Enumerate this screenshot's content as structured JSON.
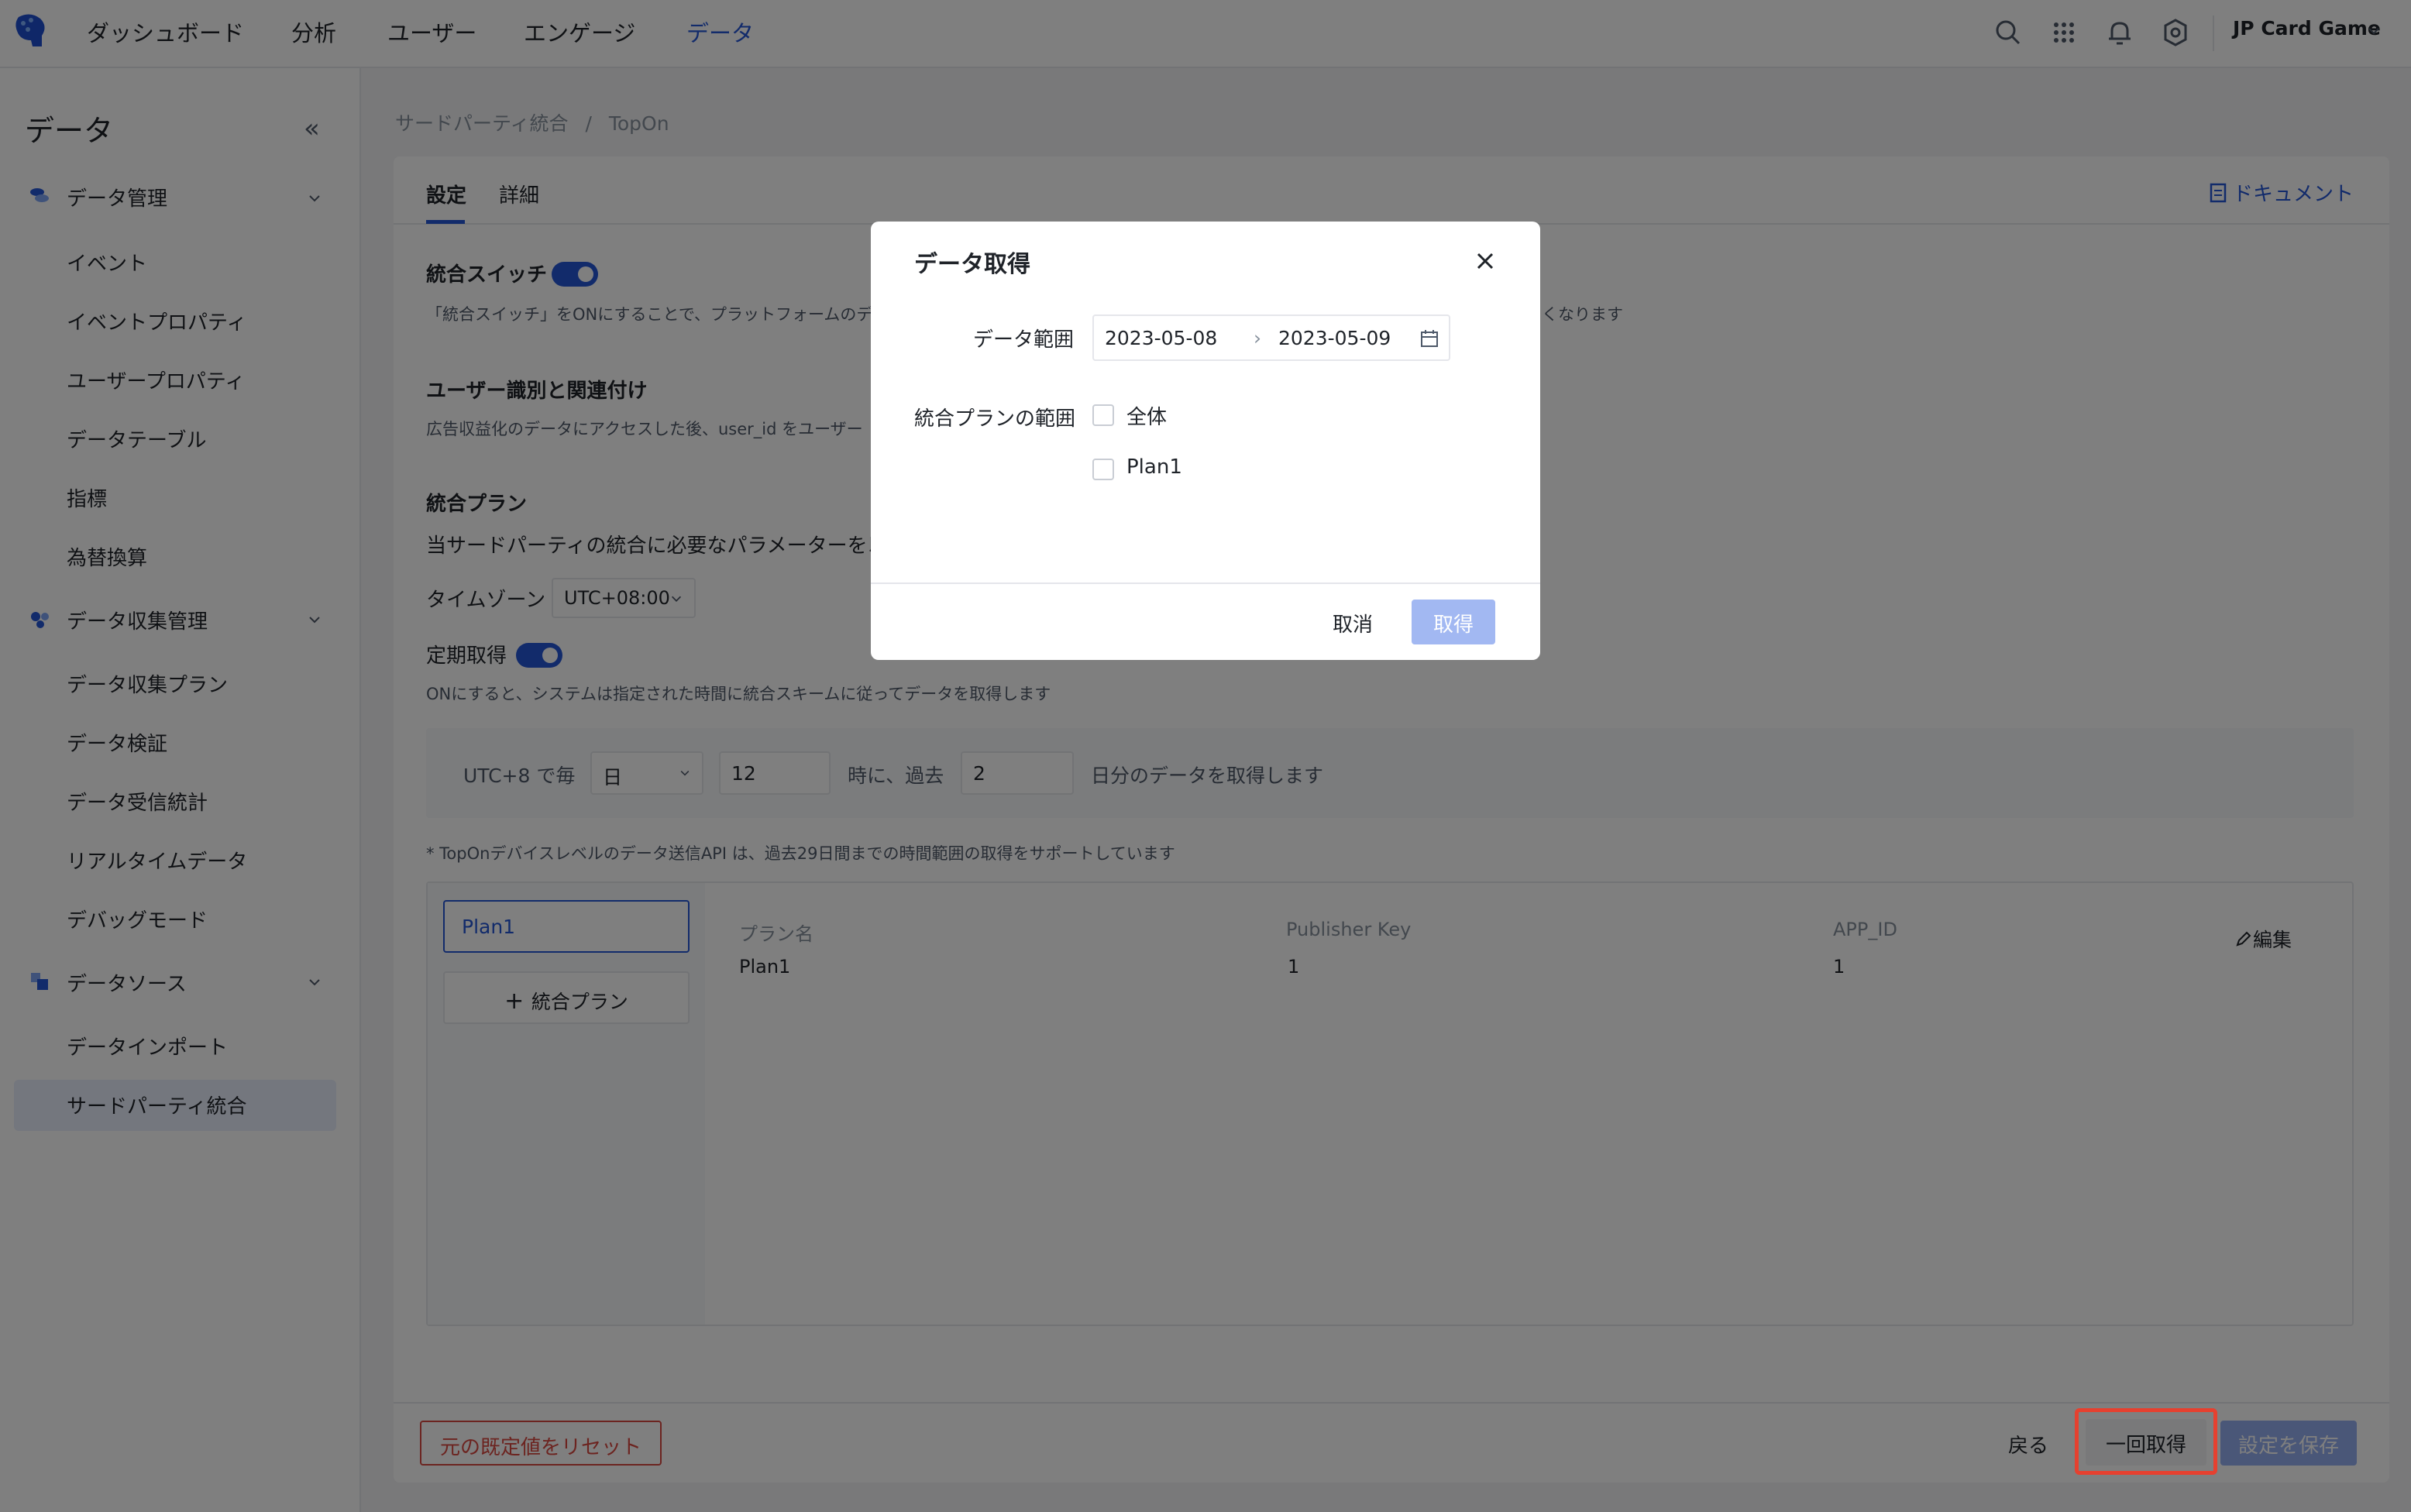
{
  "topnav": {
    "items": [
      "ダッシュボード",
      "分析",
      "ユーザー",
      "エンゲージ",
      "データ"
    ],
    "active_index": 4,
    "project": "JP Card Game"
  },
  "sidebar": {
    "title": "データ",
    "groups": [
      {
        "label": "データ管理",
        "items": [
          "イベント",
          "イベントプロパティ",
          "ユーザープロパティ",
          "データテーブル",
          "指標",
          "為替換算"
        ]
      },
      {
        "label": "データ収集管理",
        "items": [
          "データ収集プラン",
          "データ検証",
          "データ受信統計",
          "リアルタイムデータ",
          "デバッグモード"
        ]
      },
      {
        "label": "データソース",
        "items": [
          "データインポート",
          "サードパーティ統合"
        ]
      }
    ],
    "active_item": "サードパーティ統合"
  },
  "breadcrumb": {
    "parent": "サードパーティ統合",
    "separator": "/",
    "current": "TopOn"
  },
  "tabs": [
    "設定",
    "詳細"
  ],
  "doc_link": "ドキュメント",
  "settings": {
    "switch_title": "統合スイッチ",
    "switch_desc_visible": "「統合スイッチ」をONにすることで、プラットフォームのデ",
    "switch_desc_tail": "くなります",
    "identify_title": "ユーザー識別と関連付け",
    "identify_desc": "広告収益化のデータにアクセスした後、user_id をユーザー",
    "plan_title": "統合プラン",
    "plan_desc": "当サードパーティの統合に必要なパラメーターを以",
    "timezone_label": "タイムゾーン",
    "timezone_value": "UTC+08:00",
    "periodic_label": "定期取得",
    "periodic_desc": "ONにすると、システムは指定された時間に統合スキームに従ってデータを取得します",
    "schedule": {
      "prefix": "UTC+8  で毎",
      "unit": "日",
      "hour": "12",
      "mid": "時に、過去",
      "days": "2",
      "suffix": "日分のデータを取得します"
    },
    "note": "* TopOnデバイスレベルのデータ送信API は、過去29日間までの時間範囲の取得をサポートしています"
  },
  "plans": {
    "tab": "Plan1",
    "add_label": "統合プラン",
    "headers": [
      "プラン名",
      "Publisher Key",
      "APP_ID"
    ],
    "row": [
      "Plan1",
      "1",
      "1"
    ],
    "edit_label": "編集"
  },
  "footer": {
    "reset": "元の既定値をリセット",
    "back": "戻る",
    "fetch_once": "一回取得",
    "save": "設定を保存"
  },
  "modal": {
    "title": "データ取得",
    "range_label": "データ範囲",
    "start_date": "2023-05-08",
    "end_date": "2023-05-09",
    "plan_scope_label": "統合プランの範囲",
    "options": [
      "全体",
      "Plan1"
    ],
    "cancel": "取消",
    "confirm": "取得"
  },
  "colors": {
    "accent": "#2456d6",
    "danger": "#d94841",
    "highlight": "#e6402f"
  }
}
